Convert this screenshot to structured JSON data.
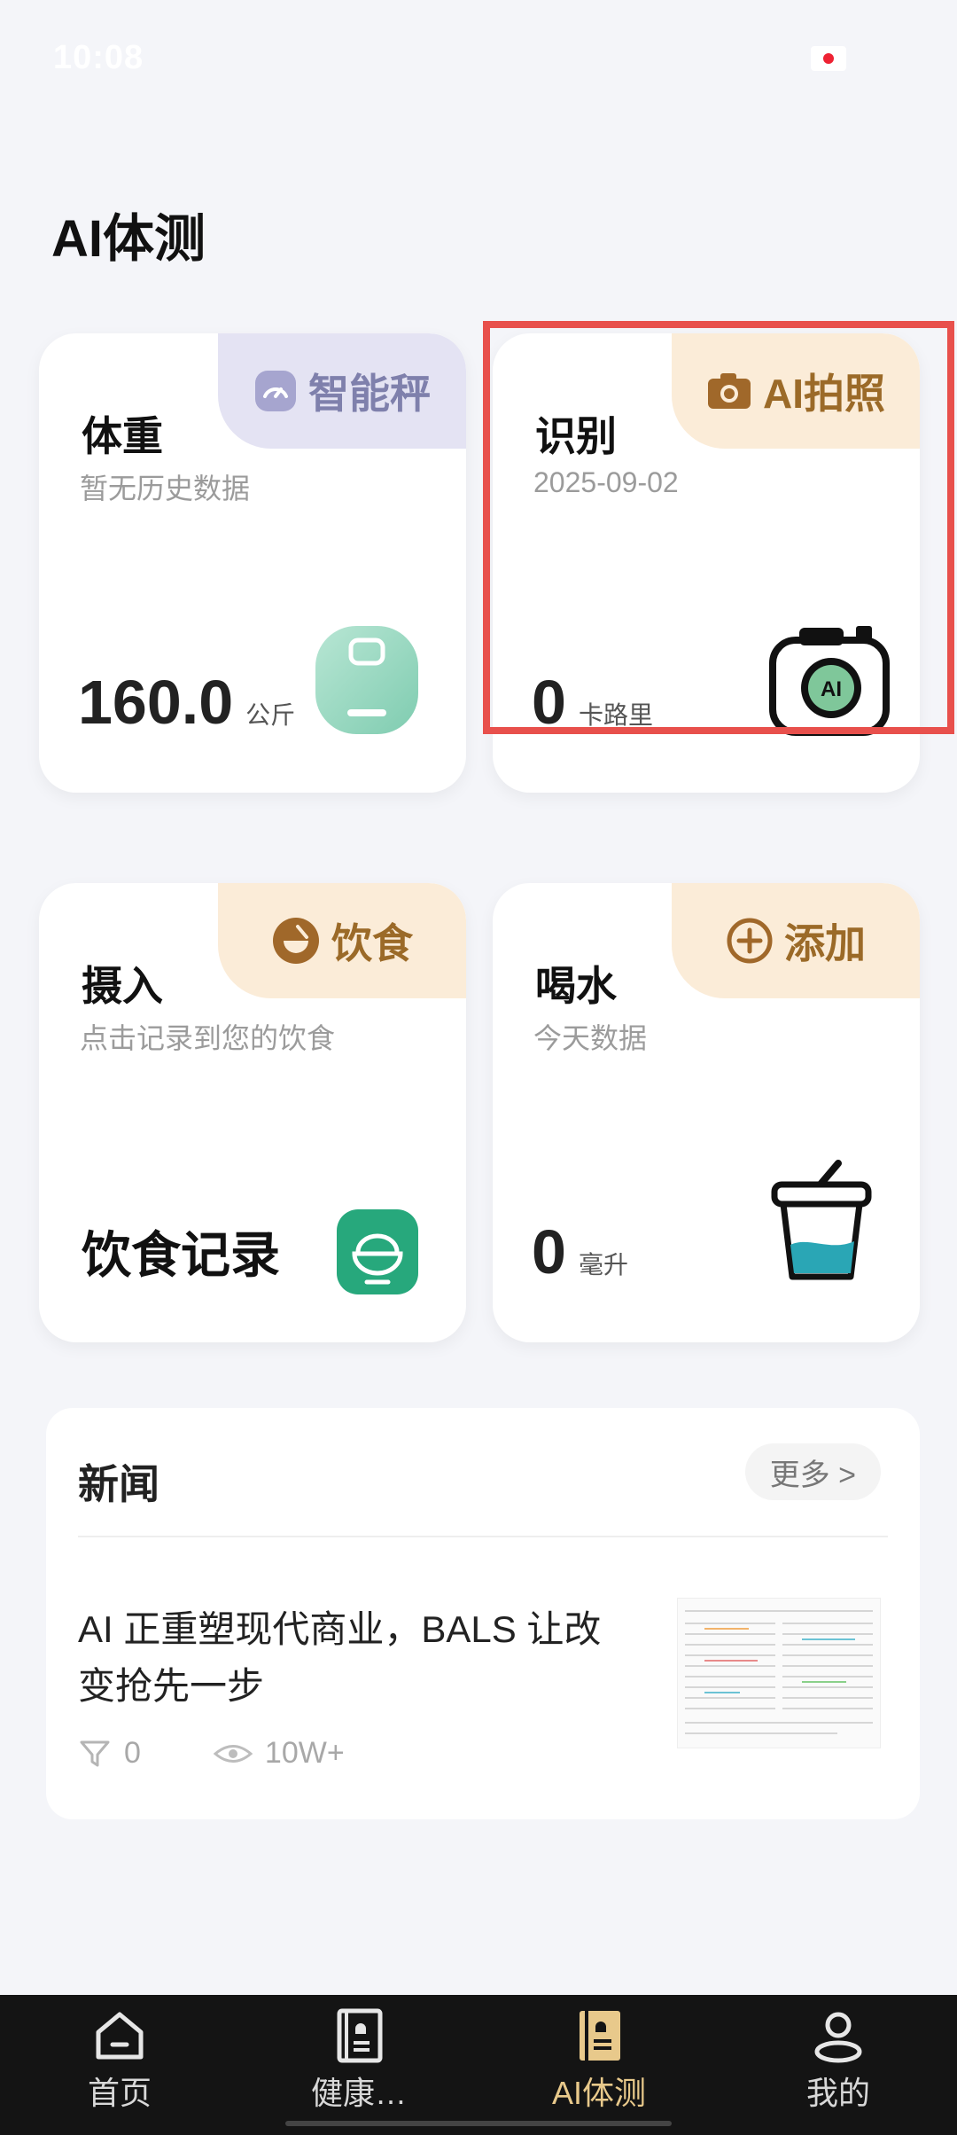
{
  "status_bar": {
    "time": "10:08"
  },
  "page_title": "AI体测",
  "cards": {
    "weight": {
      "title": "体重",
      "subtitle": "暂无历史数据",
      "tab_label": "智能秤",
      "value": "160.0",
      "unit": "公斤"
    },
    "recognize": {
      "title": "识别",
      "subtitle": "2025-09-02",
      "tab_label": "AI拍照",
      "value": "0",
      "unit": "卡路里"
    },
    "intake": {
      "title": "摄入",
      "subtitle": "点击记录到您的饮食",
      "tab_label": "饮食",
      "record_label": "饮食记录"
    },
    "water": {
      "title": "喝水",
      "subtitle": "今天数据",
      "tab_label": "添加",
      "value": "0",
      "unit": "毫升"
    }
  },
  "news": {
    "header": "新闻",
    "more_label": "更多 >",
    "item": {
      "headline": "AI 正重塑现代商业，BALS 让改变抢先一步",
      "likes": "0",
      "views": "10W+"
    }
  },
  "tabbar": {
    "items": [
      {
        "label": "首页",
        "icon": "home-icon"
      },
      {
        "label": "健康…",
        "icon": "health-book-icon"
      },
      {
        "label": "AI体测",
        "icon": "ai-test-icon"
      },
      {
        "label": "我的",
        "icon": "profile-icon"
      }
    ],
    "active_index": 2
  },
  "colors": {
    "background": "#f4f5f9",
    "highlight": "#e8504c",
    "accent_active": "#e8c98b",
    "tab_purple": "#e4e3f3",
    "tab_peach": "#fbecd8",
    "green": "#27a87c"
  }
}
